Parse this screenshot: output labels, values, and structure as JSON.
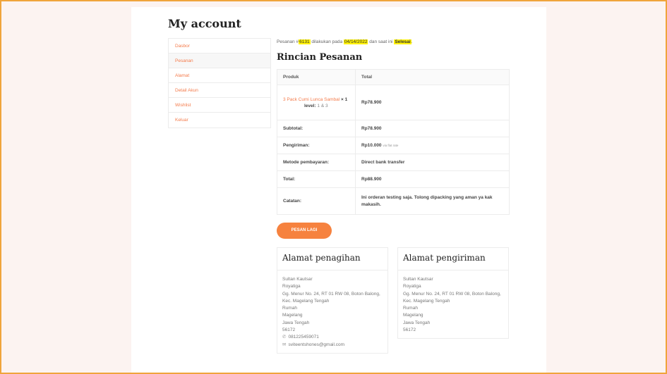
{
  "page": {
    "title": "My account"
  },
  "nav": {
    "items": [
      {
        "label": "Dasbor",
        "name": "nav-dasbor"
      },
      {
        "label": "Pesanan",
        "name": "nav-pesanan"
      },
      {
        "label": "Alamat",
        "name": "nav-alamat"
      },
      {
        "label": "Detail Akun",
        "name": "nav-detail-akun"
      },
      {
        "label": "Wishlist",
        "name": "nav-wishlist"
      },
      {
        "label": "Keluar",
        "name": "nav-keluar"
      }
    ]
  },
  "notice": {
    "prefix": "Pesanan #",
    "order_no": "6131",
    "mid": " dilakukan pada ",
    "date": "04/14/2022",
    "mid2": " dan saat ini ",
    "status": "Selesai",
    "suffix": "."
  },
  "details": {
    "heading": "Rincian Pesanan",
    "col_product": "Produk",
    "col_total": "Total",
    "product_name": "3 Pack Cumi Lunca Sambal",
    "product_qty": " × 1",
    "product_meta_label": "level:",
    "product_meta_value": " 1 & 3",
    "product_total": "Rp78.900",
    "subtotal_label": "Subtotal:",
    "subtotal_value": "Rp78.900",
    "shipping_label": "Pengiriman:",
    "shipping_value": "Rp10.000",
    "shipping_method": "via flat rate",
    "payment_label": "Metode pembayaran:",
    "payment_value": "Direct bank transfer",
    "total_label": "Total:",
    "total_value": "Rp88.900",
    "note_label": "Catatan:",
    "note_value": "Ini orderan testing saja. Tolong dipacking yang aman ya kak makasih."
  },
  "order_again": {
    "label": "PESAN LAGI"
  },
  "billing": {
    "heading": "Alamat penagihan",
    "name": "Sultan Kautsar",
    "company": "Royatiga",
    "street": "Gg. Menur No. 24, RT 01 RW 08, Boton Balong, Kec. Magelang Tengah",
    "type": "Rumah",
    "city": "Magelang",
    "province": "Jawa Tengah",
    "postcode": "56172",
    "phone": "081225459071",
    "email": "sviteentshones@gmail.com"
  },
  "shipping": {
    "heading": "Alamat pengiriman",
    "name": "Sultan Kautsar",
    "company": "Royatiga",
    "street": "Gg. Menur No. 24, RT 01 RW 08, Boton Balong, Kec. Magelang Tengah",
    "type": "Rumah",
    "city": "Magelang",
    "province": "Jawa Tengah",
    "postcode": "56172"
  },
  "colors": {
    "accent": "#f47b4b",
    "button": "#f6823f",
    "highlight": "#fff200",
    "frame": "#f0a43c"
  }
}
